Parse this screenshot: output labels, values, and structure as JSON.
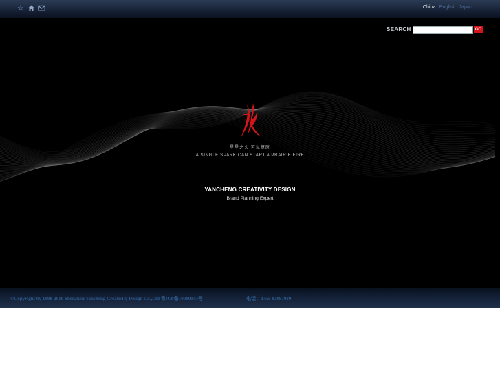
{
  "header": {
    "icons": [
      "star-icon",
      "home-icon",
      "mail-icon"
    ],
    "languages": {
      "china": "China",
      "english": "English",
      "japan": "Japan"
    }
  },
  "search": {
    "label": "SEARCH",
    "value": "",
    "button_label": "GO"
  },
  "hero": {
    "logo_glyph": "yancheng-logo",
    "slogan_cn": "星星之火 可以燎原",
    "slogan_en": "A SINGLE SPARK CAN START A PRAIRIE FIRE",
    "company": "YANCHENG CREATIVITY DESIGN",
    "tagline": "Brand Planning Expert"
  },
  "footer": {
    "copyright": "©Copyright by 1998-2010 Shenzhen Yancheng Creativity Design Co.,Ltd  粤ICP备10000143号",
    "phone": "电话：0755-83997039"
  },
  "colors": {
    "accent_red": "#d4141b",
    "top_bar": "#182338",
    "footer_text": "#2c5a8e"
  }
}
